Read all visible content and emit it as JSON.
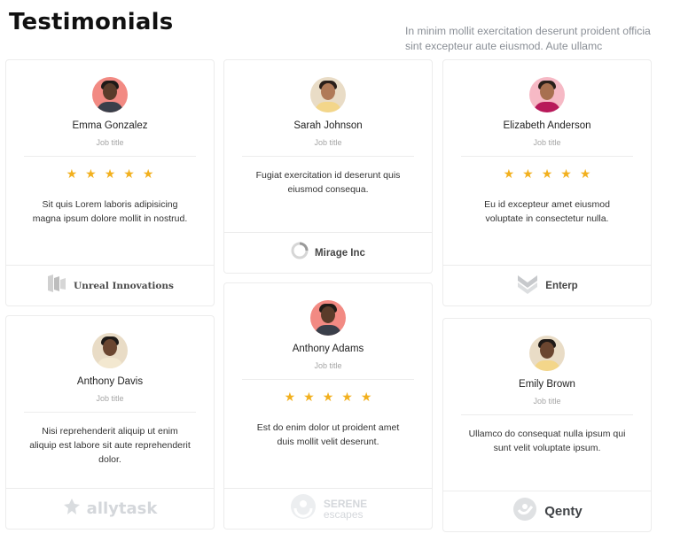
{
  "header": {
    "title": "Testimonials",
    "intro": "In minim mollit exercitation deserunt proident officia sint excepteur aute eiusmod. Aute ullamc"
  },
  "colors": {
    "star": "#f2b01e",
    "border": "#ececec",
    "muted": "#8a8f96"
  },
  "cards": [
    {
      "name": "Emma Gonzalez",
      "job": "Job title",
      "rating": 5,
      "stars": "★★★★★",
      "quote": "Sit quis Lorem laboris adipisicing magna ipsum dolore mollit in nostrud.",
      "company": "Unreal Innovations",
      "logo_icon": "unreal-logo-icon"
    },
    {
      "name": "Anthony Davis",
      "job": "Job title",
      "quote": "Nisi reprehenderit aliquip ut enim aliquip est labore sit aute reprehenderit dolor.",
      "company": "allytask",
      "logo_icon": "allytask-logo-icon"
    },
    {
      "name": "Sarah Johnson",
      "job": "Job title",
      "quote": "Fugiat exercitation id deserunt quis eiusmod consequa.",
      "company": "Mirage Inc",
      "logo_icon": "mirage-logo-icon"
    },
    {
      "name": "Anthony Adams",
      "job": "Job title",
      "rating": 5,
      "stars": "★★★★★",
      "quote": "Est do enim dolor ut proident amet duis mollit velit deserunt.",
      "company_line1": "SERENE",
      "company_line2": "escapes",
      "logo_icon": "serene-logo-icon"
    },
    {
      "name": "Elizabeth Anderson",
      "job": "Job title",
      "rating": 5,
      "stars": "★★★★★",
      "quote": "Eu id excepteur amet eiusmod voluptate in consectetur nulla.",
      "company": "Enterp",
      "logo_icon": "enterp-logo-icon"
    },
    {
      "name": "Emily Brown",
      "job": "Job title",
      "quote": "Ullamco do consequat nulla ipsum qui sunt velit voluptate ipsum.",
      "company": "Qenty",
      "logo_icon": "qenty-logo-icon"
    }
  ]
}
